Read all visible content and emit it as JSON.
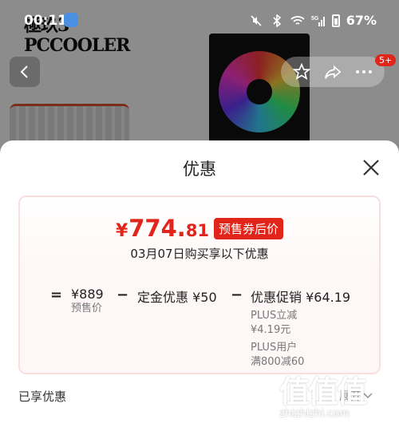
{
  "status_bar": {
    "time": "00:11",
    "battery": "67%",
    "network": "5G"
  },
  "background": {
    "brand_line1": "極玖3",
    "brand_line2": "PCCOOLER",
    "badge": "5+"
  },
  "sheet": {
    "title": "优惠",
    "price": {
      "currency": "¥",
      "integer": "774.",
      "decimal": "81"
    },
    "price_tag": "预售券后价",
    "purchase_note": "03月07日购买享以下优惠",
    "calc": {
      "eq": "=",
      "base_value": "¥889",
      "base_label": "预售价",
      "minus1": "−",
      "deposit_label": "定金优惠",
      "deposit_value": "¥50",
      "minus2": "−",
      "promo_label": "优惠促销",
      "promo_value": "¥64.19",
      "plus_discount_label": "PLUS立减",
      "plus_discount_value": "¥4.19元",
      "plus_user_label": "PLUS用户",
      "plus_user_value": "满800减60"
    },
    "footer_label": "已享优惠",
    "collapse_label": "展开"
  },
  "watermark": {
    "logo": "值值值",
    "url": "zhizhizhi.com"
  },
  "colors": {
    "accent": "#e1251b",
    "overlay": "rgba(0,0,0,0.45)"
  }
}
